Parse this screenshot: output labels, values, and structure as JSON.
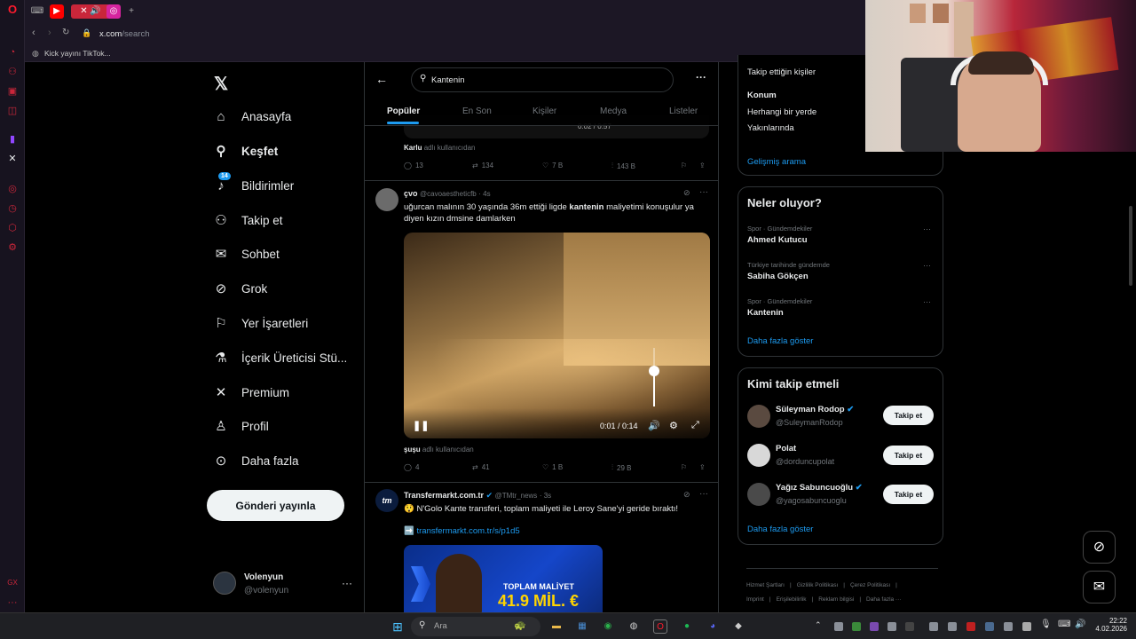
{
  "browser": {
    "url_domain": "x.com",
    "url_path": "/search",
    "bookmark_label": "Kick yayını TikTok..."
  },
  "nav": {
    "items": [
      {
        "label": "Anasayfa",
        "icon": "home-icon"
      },
      {
        "label": "Keşfet",
        "icon": "search-icon"
      },
      {
        "label": "Bildirimler",
        "icon": "bell-icon"
      },
      {
        "label": "Takip et",
        "icon": "follow-icon"
      },
      {
        "label": "Sohbet",
        "icon": "mail-icon"
      },
      {
        "label": "Grok",
        "icon": "grok-icon"
      },
      {
        "label": "Yer İşaretleri",
        "icon": "bookmark-icon"
      },
      {
        "label": "İçerik Üreticisi Stü...",
        "icon": "flask-icon"
      },
      {
        "label": "Premium",
        "icon": "x-logo-icon"
      },
      {
        "label": "Profil",
        "icon": "profile-icon"
      },
      {
        "label": "Daha fazla",
        "icon": "more-circle-icon"
      }
    ],
    "notif_badge": "14",
    "post_label": "Gönderi yayınla",
    "account": {
      "name": "Volenyun",
      "handle": "@volenyun"
    }
  },
  "search": {
    "query": "Kantenin",
    "tabs": [
      "Popüler",
      "En Son",
      "Kişiler",
      "Medya",
      "Listeler"
    ]
  },
  "tweet0": {
    "cut_time": "0:02 / 0:57",
    "caption_user": "Karlu",
    "caption_suffix": "adlı kullanıcıdan",
    "replies": "13",
    "reposts": "134",
    "likes": "7 B",
    "views": "143 B"
  },
  "tweet1": {
    "name": "çvo",
    "handle": "@cavoaestheticfb",
    "time": "· 4s",
    "text_before": "uğurcan malının 30 yaşında 36m ettiği ligde ",
    "text_bold": "kantenin",
    "text_after": " maliyetimi konuşulur ya diyen kızın dmsine damlarken",
    "video_time": "0:01 / 0:14",
    "video_volume": 0.6,
    "caption_user": "şuşu",
    "caption_suffix": "adlı kullanıcıdan",
    "replies": "4",
    "reposts": "41",
    "likes": "1 B",
    "views": "29 B"
  },
  "tweet2": {
    "name": "Transfermarkt.com.tr",
    "handle": "@TMtr_news",
    "time": "· 3s",
    "avatar_text": "tm",
    "emoji": "😲",
    "text": "N'Golo Kante transferi, toplam maliyeti ile Leroy Sane'yi geride bıraktı!",
    "arrow": "➡️",
    "link": "transfermarkt.com.tr/s/p1d5",
    "image_title": "TOPLAM MALİYET",
    "image_value": "41.9 MİL. €"
  },
  "right": {
    "filter_follow": "Takip ettiğin kişiler",
    "location_title": "Konum",
    "location_any": "Herhangi bir yerde",
    "location_near": "Yakınlarında",
    "advanced": "Gelişmiş arama",
    "trends_title": "Neler oluyor?",
    "trends": [
      {
        "context": "Spor · Gündemdekiler",
        "name": "Ahmed Kutucu"
      },
      {
        "context": "Türkiye tarihinde gündemde",
        "name": "Sabiha Gökçen"
      },
      {
        "context": "Spor · Gündemdekiler",
        "name": "Kantenin"
      }
    ],
    "show_more": "Daha fazla göster",
    "wtf_title": "Kimi takip etmeli",
    "wtf": [
      {
        "name": "Süleyman Rodop",
        "handle": "@SuleymanRodop",
        "verified": true
      },
      {
        "name": "Polat",
        "handle": "@dorduncupolat",
        "verified": false
      },
      {
        "name": "Yağız Sabuncuoğlu",
        "handle": "@yagosabuncuoglu",
        "verified": true
      }
    ],
    "follow_label": "Takip et",
    "footer": [
      "Hizmet Şartları",
      "|",
      "Gizlilik Politikası",
      "|",
      "Çerez Politikası",
      "|"
    ],
    "footer2": [
      "Imprint",
      "|",
      "Erişilebilirlik",
      "|",
      "Reklam bilgisi",
      "|",
      "Daha fazla ···"
    ]
  },
  "taskbar": {
    "search_placeholder": "Ara",
    "time": "22:22",
    "date": "4.02.2026"
  },
  "colors": {
    "accent": "#1d9bf0",
    "verified": "#1d9bf0",
    "opera": "#ff1b2d"
  }
}
